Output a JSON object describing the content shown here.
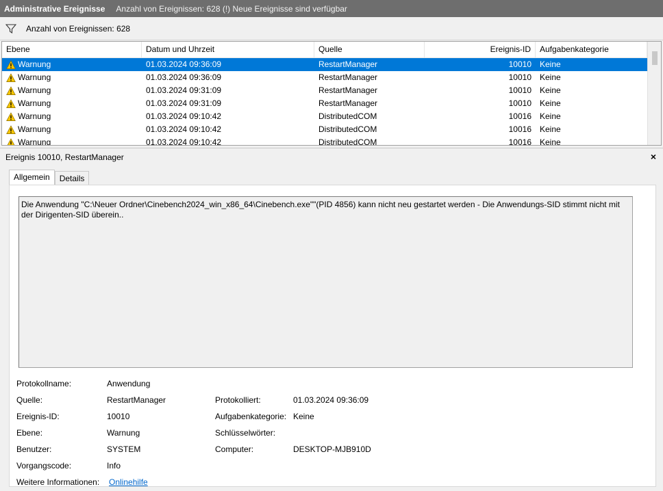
{
  "title": {
    "app": "Administrative Ereignisse",
    "info": "Anzahl von Ereignissen: 628 (!) Neue Ereignisse sind verfügbar"
  },
  "filter": {
    "count_label": "Anzahl von Ereignissen: 628"
  },
  "columns": [
    "Ebene",
    "Datum und Uhrzeit",
    "Quelle",
    "Ereignis-ID",
    "Aufgabenkategorie"
  ],
  "events": [
    {
      "level": "Warnung",
      "date": "01.03.2024 09:36:09",
      "source": "RestartManager",
      "id": "10010",
      "category": "Keine"
    },
    {
      "level": "Warnung",
      "date": "01.03.2024 09:36:09",
      "source": "RestartManager",
      "id": "10010",
      "category": "Keine"
    },
    {
      "level": "Warnung",
      "date": "01.03.2024 09:31:09",
      "source": "RestartManager",
      "id": "10010",
      "category": "Keine"
    },
    {
      "level": "Warnung",
      "date": "01.03.2024 09:31:09",
      "source": "RestartManager",
      "id": "10010",
      "category": "Keine"
    },
    {
      "level": "Warnung",
      "date": "01.03.2024 09:10:42",
      "source": "DistributedCOM",
      "id": "10016",
      "category": "Keine"
    },
    {
      "level": "Warnung",
      "date": "01.03.2024 09:10:42",
      "source": "DistributedCOM",
      "id": "10016",
      "category": "Keine"
    },
    {
      "level": "Warnung",
      "date": "01.03.2024 09:10:42",
      "source": "DistributedCOM",
      "id": "10016",
      "category": "Keine"
    }
  ],
  "detail": {
    "header": "Ereignis 10010, RestartManager",
    "close": "×",
    "tabs": [
      "Allgemein",
      "Details"
    ],
    "description": "Die Anwendung \"C:\\Neuer Ordner\\Cinebench2024_win_x86_64\\Cinebench.exe\"\"(PID 4856) kann  nicht neu gestartet werden - Die Anwendungs-SID stimmt nicht mit der Dirigenten-SID überein..",
    "props": {
      "protokollname_label": "Protokollname:",
      "protokollname": "Anwendung",
      "quelle_label": "Quelle:",
      "quelle": "RestartManager",
      "protokolliert_label": "Protokolliert:",
      "protokolliert": "01.03.2024 09:36:09",
      "ereignis_id_label": "Ereignis-ID:",
      "ereignis_id": "10010",
      "aufgabenkategorie_label": "Aufgabenkategorie:",
      "aufgabenkategorie": "Keine",
      "ebene_label": "Ebene:",
      "ebene": "Warnung",
      "schluessel_label": "Schlüsselwörter:",
      "schluessel": "",
      "benutzer_label": "Benutzer:",
      "benutzer": "SYSTEM",
      "computer_label": "Computer:",
      "computer": "DESKTOP-MJB910D",
      "vorgang_label": "Vorgangscode:",
      "vorgang": "Info",
      "weitere_label": "Weitere Informationen:",
      "weitere_link": "Onlinehilfe"
    }
  },
  "colors": {
    "selection": "#0078d7",
    "titlebar": "#6e6e6e",
    "link": "#0066cc"
  }
}
